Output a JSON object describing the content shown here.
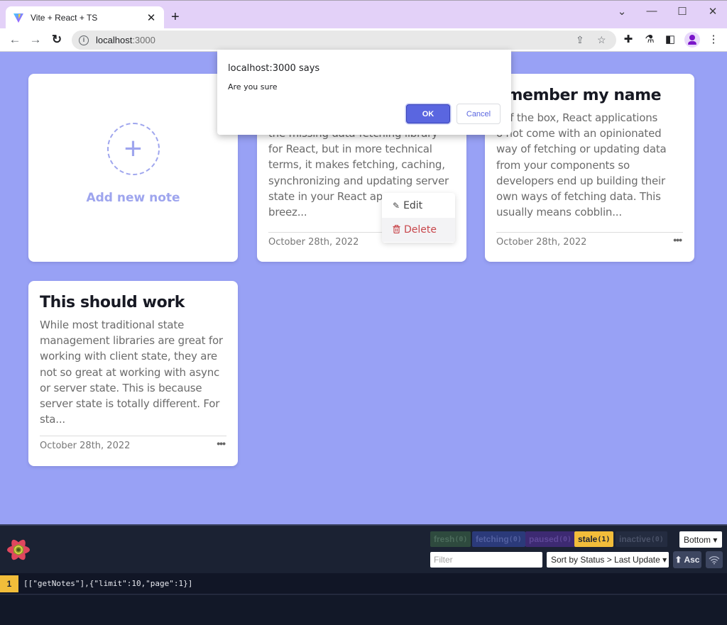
{
  "browser": {
    "tab_title": "Vite + React + TS",
    "tab_close": "✕",
    "new_tab": "+",
    "url_host": "localhost",
    "url_port": ":3000",
    "window_controls": {
      "dropdown": "⌄",
      "minimize": "—",
      "maximize": "☐",
      "close": "✕"
    },
    "nav": {
      "back": "←",
      "forward": "→",
      "reload": "↻"
    }
  },
  "dialog": {
    "title": "localhost:3000 says",
    "message": "Are you sure",
    "ok_label": "OK",
    "cancel_label": "Cancel"
  },
  "notes": {
    "add_label": "Add new note",
    "add_icon": "+",
    "more_icon": "•••",
    "items": [
      {
        "title": "",
        "body_lines": [
          "the missing data-fetching library",
          "for React, but in more technical",
          "terms, it makes fetching, caching,",
          "synchronizing and updating server",
          "state in your React ap",
          "breez..."
        ],
        "date": "October 28th, 2022"
      },
      {
        "title": "emember my name",
        "body_lines": [
          "t of the box, React applications",
          "o not come with an opinionated",
          "way of fetching or updating data",
          "from your components so",
          "developers end up building their",
          "own ways of fetching data. This",
          "usually means cobblin..."
        ],
        "date": "October 28th, 2022"
      },
      {
        "title": "This should work",
        "body_lines": [
          "While most traditional state",
          "management libraries are great for",
          "working with client state, they are",
          "not so great at working with async",
          "or server state. This is because",
          "server state is totally different. For",
          "sta..."
        ],
        "date": "October 28th, 2022"
      }
    ]
  },
  "context_menu": {
    "edit_label": "Edit",
    "edit_icon": "✎",
    "delete_label": "Delete",
    "delete_icon": "🗑"
  },
  "devtools": {
    "status_pills": [
      {
        "label": "fresh",
        "count": "(0)"
      },
      {
        "label": "fetching",
        "count": "(0)"
      },
      {
        "label": "paused",
        "count": "(0)"
      },
      {
        "label": "stale",
        "count": "(1)"
      },
      {
        "label": "inactive",
        "count": "(0)"
      }
    ],
    "position_select": "Bottom ▾",
    "filter_placeholder": "Filter",
    "sort_select": "Sort by Status > Last Update ▾",
    "asc_label": "⬆ Asc",
    "queries": [
      {
        "observers": "1",
        "key": "[[\"getNotes\"],{\"limit\":10,\"page\":1}]"
      }
    ]
  }
}
